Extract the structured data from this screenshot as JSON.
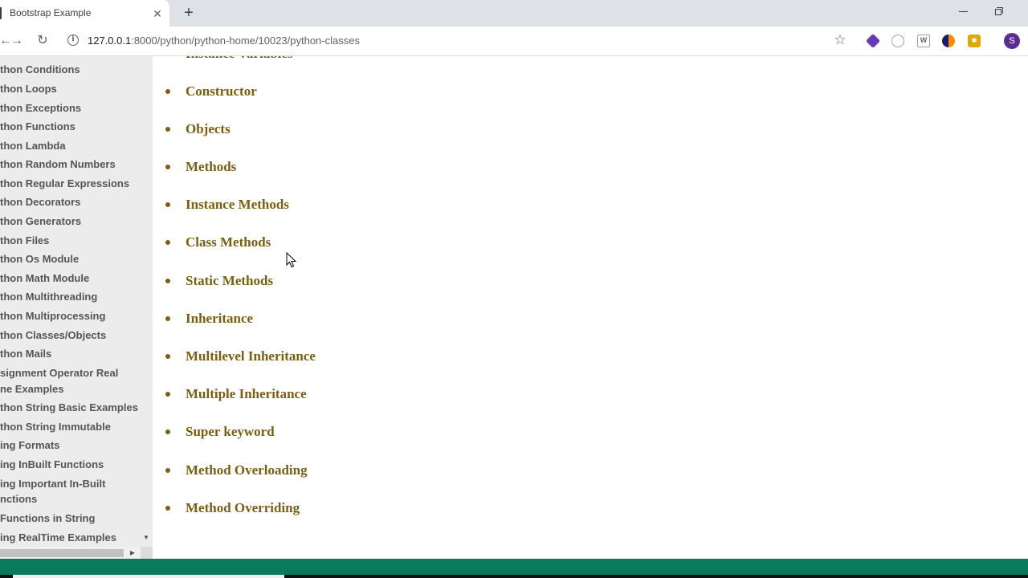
{
  "browser": {
    "tab_title": "Bootstrap Example",
    "tab_close": "✕",
    "new_tab": "+",
    "url_host": "127.0.0.1",
    "url_rest": ":8000/python/python-home/10023/python-classes",
    "profile_initial": "S",
    "icons": [
      "back-icon",
      "forward-icon",
      "reload-icon",
      "info-icon",
      "star-icon",
      "extension-icons",
      "profile-avatar"
    ]
  },
  "sidebar": {
    "items": [
      "thon Conditions",
      "thon Loops",
      "thon Exceptions",
      "thon Functions",
      "thon Lambda",
      "thon Random Numbers",
      "thon Regular Expressions",
      "thon Decorators",
      "thon Generators",
      "thon Files",
      "thon Os Module",
      "thon Math Module",
      "thon Multithreading",
      "thon Multiprocessing",
      "thon Classes/Objects",
      "thon Mails",
      "signment Operator Real",
      "ne Examples",
      "thon String Basic Examples",
      "thon String Immutable",
      "ing Formats",
      "ing InBuilt Functions",
      "ing Important In-Built",
      "nctions",
      "Functions in String",
      "ing RealTime Examples"
    ]
  },
  "main": {
    "partial_top_item": "Instance Variables",
    "topics": [
      "Constructor",
      "Objects",
      "Methods",
      "Instance Methods",
      "Class Methods",
      "Static Methods",
      "Inheritance",
      "Multilevel Inheritance",
      "Multiple Inheritance",
      "Super keyword",
      "Method Overloading",
      "Method Overriding"
    ]
  },
  "colors": {
    "topic_text": "#7a5f10",
    "sidebar_bg": "#ececec",
    "footer": "#0a7a5a"
  }
}
